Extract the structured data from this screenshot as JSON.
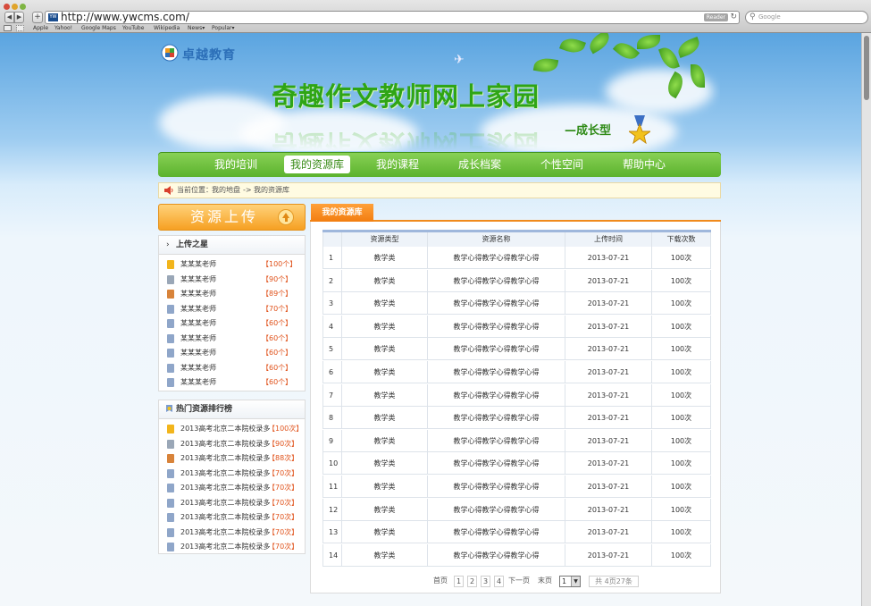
{
  "browser": {
    "url": "http://www.ywcms.com/",
    "reader_label": "Reader",
    "search_placeholder": "Google",
    "bookmarks": [
      "Apple",
      "Yahoo!",
      "Google Maps",
      "YouTube",
      "Wikipedia",
      "News▾",
      "Popular▾"
    ]
  },
  "header": {
    "logo_text": "卓越教育",
    "title": "奇趣作文教师网上家园",
    "subtitle": "—成长型"
  },
  "nav": {
    "items": [
      "我的培训",
      "我的资源库",
      "我的课程",
      "成长档案",
      "个性空间",
      "帮助中心"
    ],
    "active_index": 1
  },
  "breadcrumb": {
    "prefix": "当前位置：",
    "path_1": "我的地盘",
    "separator": "->",
    "path_2": "我的资源库"
  },
  "sidebar": {
    "upload_label": "资源上传",
    "stars": {
      "title": "上传之星",
      "rows": [
        {
          "name": "某某某老师",
          "count": "【100个】"
        },
        {
          "name": "某某某老师",
          "count": "【90个】"
        },
        {
          "name": "某某某老师",
          "count": "【89个】"
        },
        {
          "name": "某某某老师",
          "count": "【70个】"
        },
        {
          "name": "某某某老师",
          "count": "【60个】"
        },
        {
          "name": "某某某老师",
          "count": "【60个】"
        },
        {
          "name": "某某某老师",
          "count": "【60个】"
        },
        {
          "name": "某某某老师",
          "count": "【60个】"
        },
        {
          "name": "某某某老师",
          "count": "【60个】"
        }
      ]
    },
    "hot": {
      "title": "热门资源排行榜",
      "rows": [
        {
          "name": "2013高考北京二本院校录多",
          "count": "【100次】"
        },
        {
          "name": "2013高考北京二本院校录多",
          "count": "【90次】"
        },
        {
          "name": "2013高考北京二本院校录多",
          "count": "【88次】"
        },
        {
          "name": "2013高考北京二本院校录多",
          "count": "【70次】"
        },
        {
          "name": "2013高考北京二本院校录多",
          "count": "【70次】"
        },
        {
          "name": "2013高考北京二本院校录多",
          "count": "【70次】"
        },
        {
          "name": "2013高考北京二本院校录多",
          "count": "【70次】"
        },
        {
          "name": "2013高考北京二本院校录多",
          "count": "【70次】"
        },
        {
          "name": "2013高考北京二本院校录多",
          "count": "【70次】"
        }
      ]
    }
  },
  "content": {
    "tab_label": "我的资源库",
    "table": {
      "headers": [
        "",
        "资源类型",
        "资源名称",
        "上传时间",
        "下载次数"
      ],
      "rows": [
        [
          "1",
          "教学类",
          "教学心得教学心得教学心得",
          "2013-07-21",
          "100次"
        ],
        [
          "2",
          "教学类",
          "教学心得教学心得教学心得",
          "2013-07-21",
          "100次"
        ],
        [
          "3",
          "教学类",
          "教学心得教学心得教学心得",
          "2013-07-21",
          "100次"
        ],
        [
          "4",
          "教学类",
          "教学心得教学心得教学心得",
          "2013-07-21",
          "100次"
        ],
        [
          "5",
          "教学类",
          "教学心得教学心得教学心得",
          "2013-07-21",
          "100次"
        ],
        [
          "6",
          "教学类",
          "教学心得教学心得教学心得",
          "2013-07-21",
          "100次"
        ],
        [
          "7",
          "教学类",
          "教学心得教学心得教学心得",
          "2013-07-21",
          "100次"
        ],
        [
          "8",
          "教学类",
          "教学心得教学心得教学心得",
          "2013-07-21",
          "100次"
        ],
        [
          "9",
          "教学类",
          "教学心得教学心得教学心得",
          "2013-07-21",
          "100次"
        ],
        [
          "10",
          "教学类",
          "教学心得教学心得教学心得",
          "2013-07-21",
          "100次"
        ],
        [
          "11",
          "教学类",
          "教学心得教学心得教学心得",
          "2013-07-21",
          "100次"
        ],
        [
          "12",
          "教学类",
          "教学心得教学心得教学心得",
          "2013-07-21",
          "100次"
        ],
        [
          "13",
          "教学类",
          "教学心得教学心得教学心得",
          "2013-07-21",
          "100次"
        ],
        [
          "14",
          "教学类",
          "教学心得教学心得教学心得",
          "2013-07-21",
          "100次"
        ]
      ]
    },
    "pager": {
      "first": "首页",
      "pages": [
        "1",
        "2",
        "3",
        "4"
      ],
      "next": "下一页",
      "last": "末页",
      "selected": "1",
      "summary": "共 4页27条"
    }
  },
  "colors": {
    "nav_green": "#5bb22d",
    "accent_orange": "#f08a1c",
    "title_green": "#2fa515",
    "logo_blue": "#2c6fb8"
  }
}
